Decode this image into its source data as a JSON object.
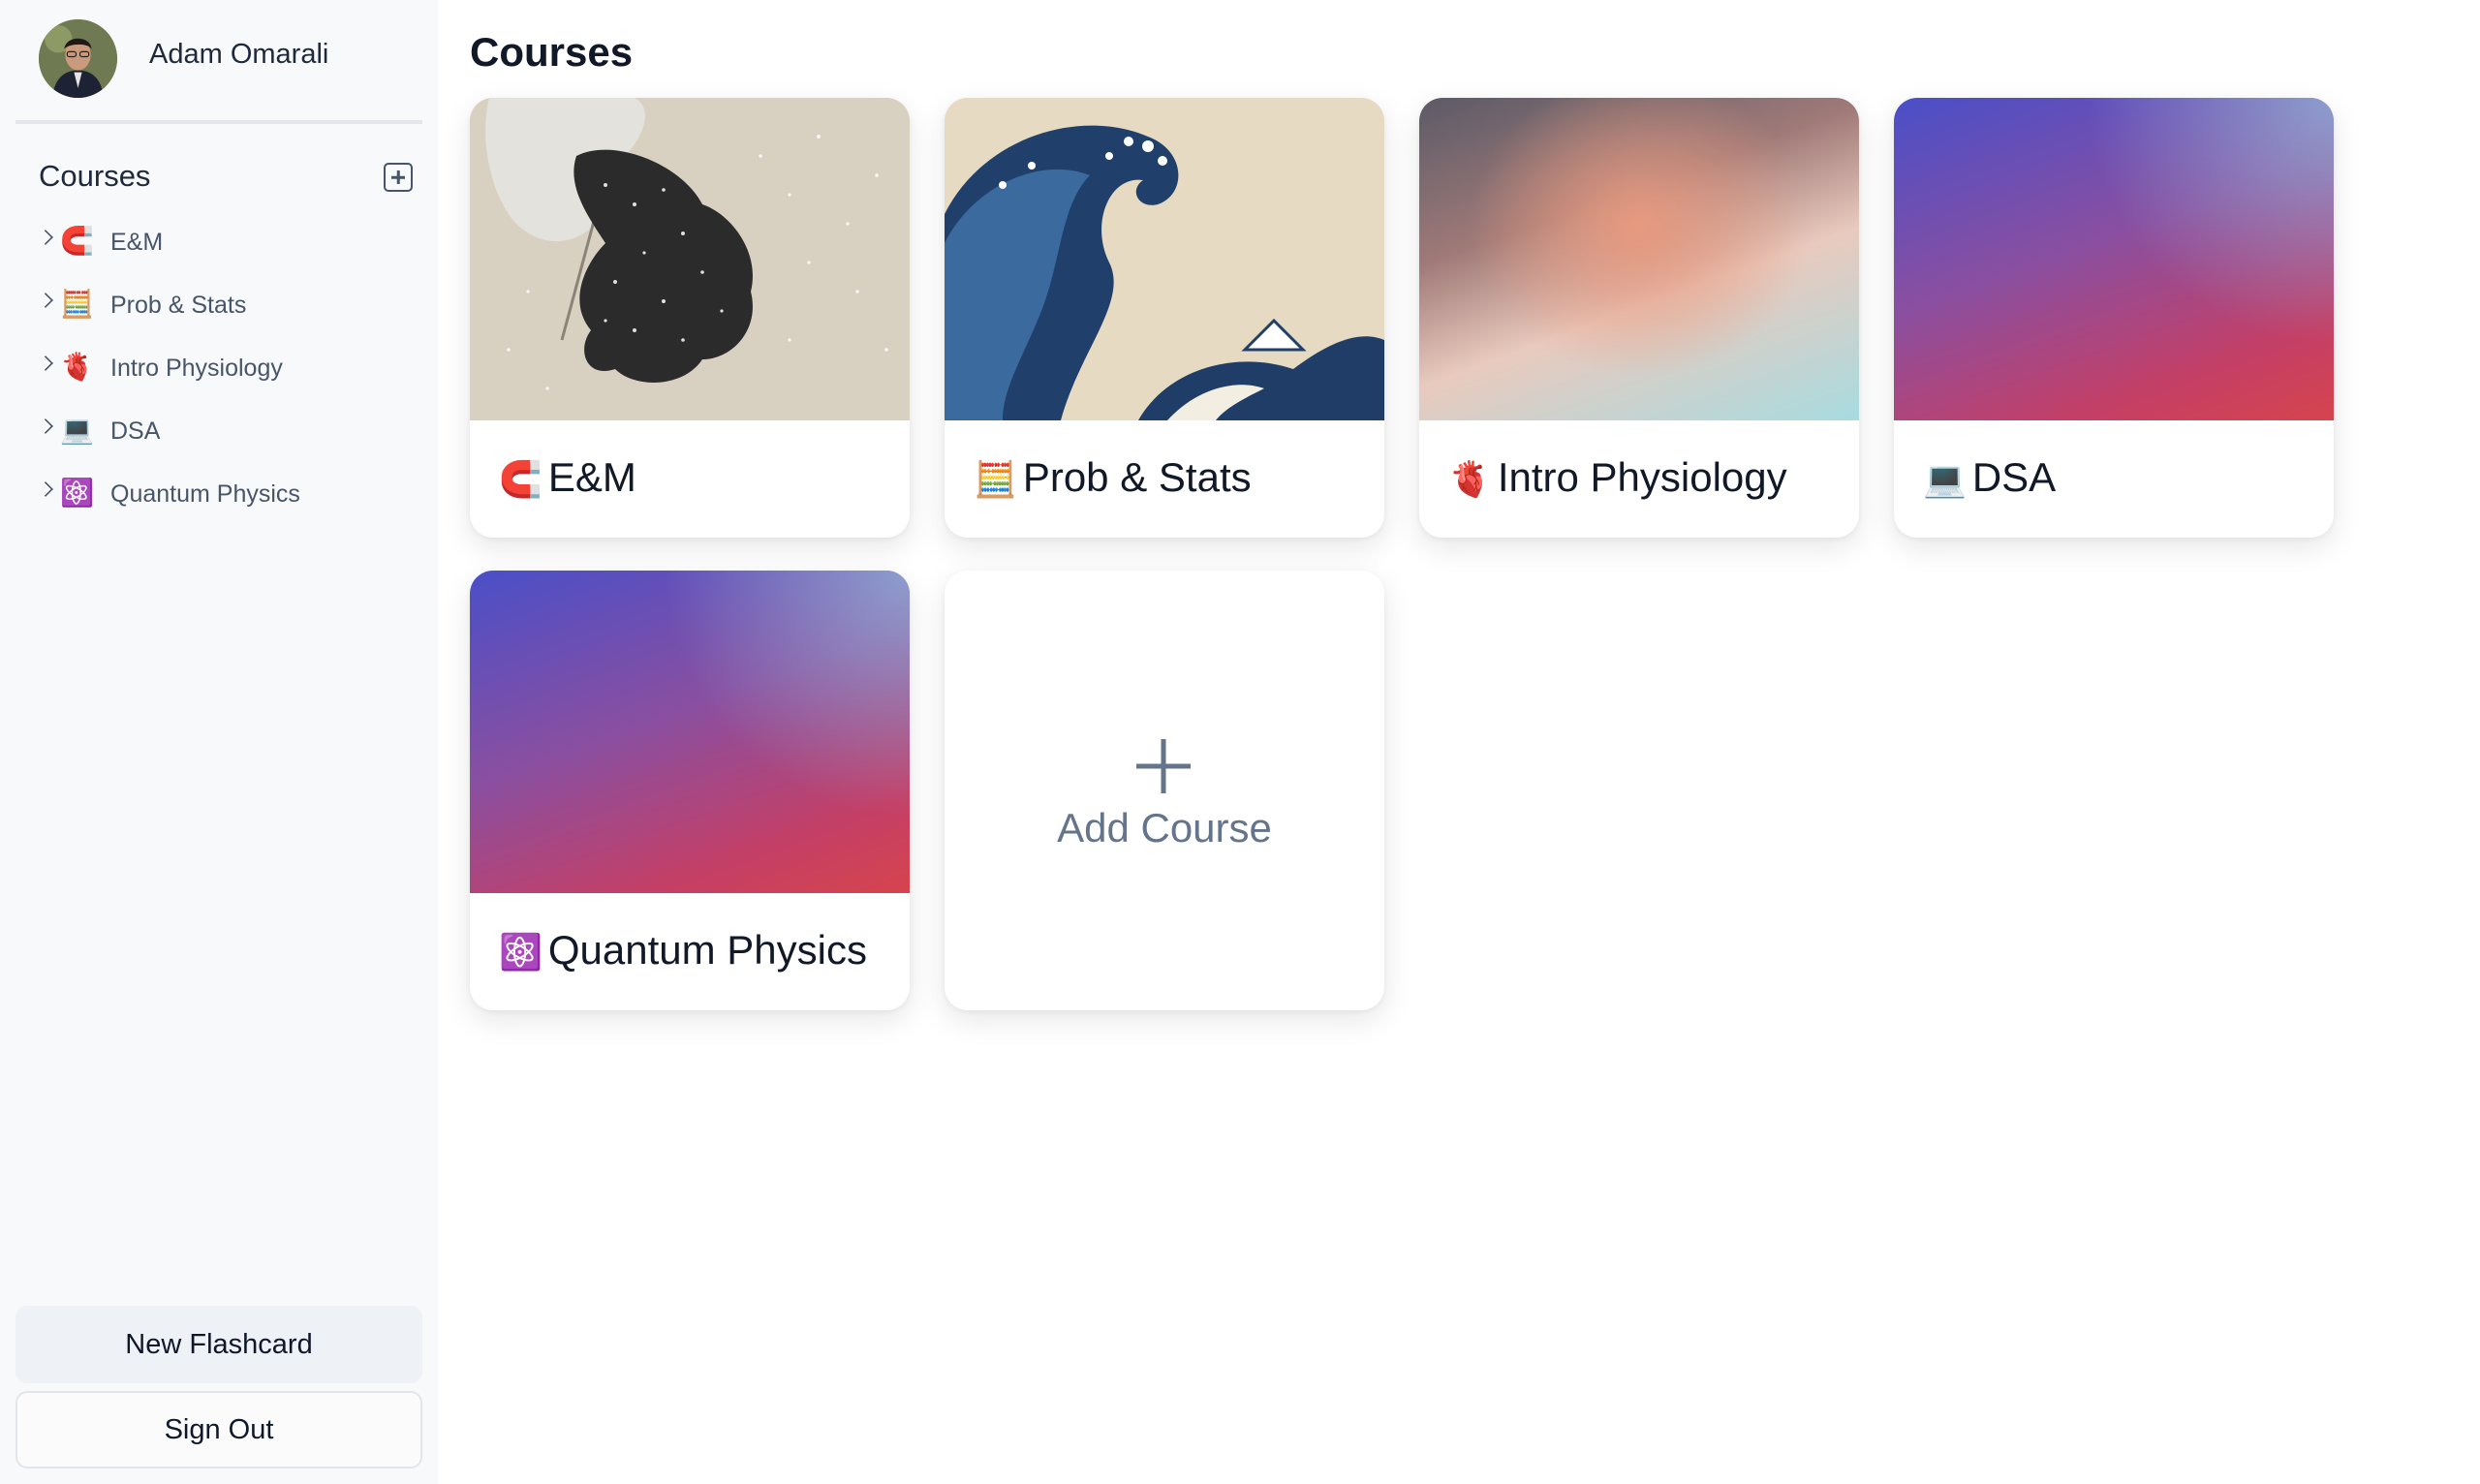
{
  "user": {
    "name": "Adam Omarali"
  },
  "sidebar": {
    "section_title": "Courses",
    "items": [
      {
        "emoji": "🧲",
        "label": "E&M"
      },
      {
        "emoji": "🧮",
        "label": "Prob & Stats"
      },
      {
        "emoji": "🫀",
        "label": "Intro Physiology"
      },
      {
        "emoji": "💻",
        "label": "DSA"
      },
      {
        "emoji": "⚛️",
        "label": "Quantum Physics"
      }
    ],
    "new_flashcard_label": "New Flashcard",
    "sign_out_label": "Sign Out"
  },
  "main": {
    "title": "Courses",
    "cards": [
      {
        "emoji": "🧲",
        "title": "E&M",
        "cover": "woodblock-snow"
      },
      {
        "emoji": "🧮",
        "title": "Prob & Stats",
        "cover": "great-wave"
      },
      {
        "emoji": "🫀",
        "title": "Intro Physiology",
        "cover": "blurred-gradient"
      },
      {
        "emoji": "💻",
        "title": "DSA",
        "cover": "purple-red-gradient"
      },
      {
        "emoji": "⚛️",
        "title": "Quantum Physics",
        "cover": "purple-red-gradient"
      }
    ],
    "add_card_label": "Add Course"
  },
  "colors": {
    "sidebar_bg": "#f8f9fb",
    "text_primary": "#111827",
    "text_muted": "#475569",
    "add_course_gray": "#64748b"
  }
}
